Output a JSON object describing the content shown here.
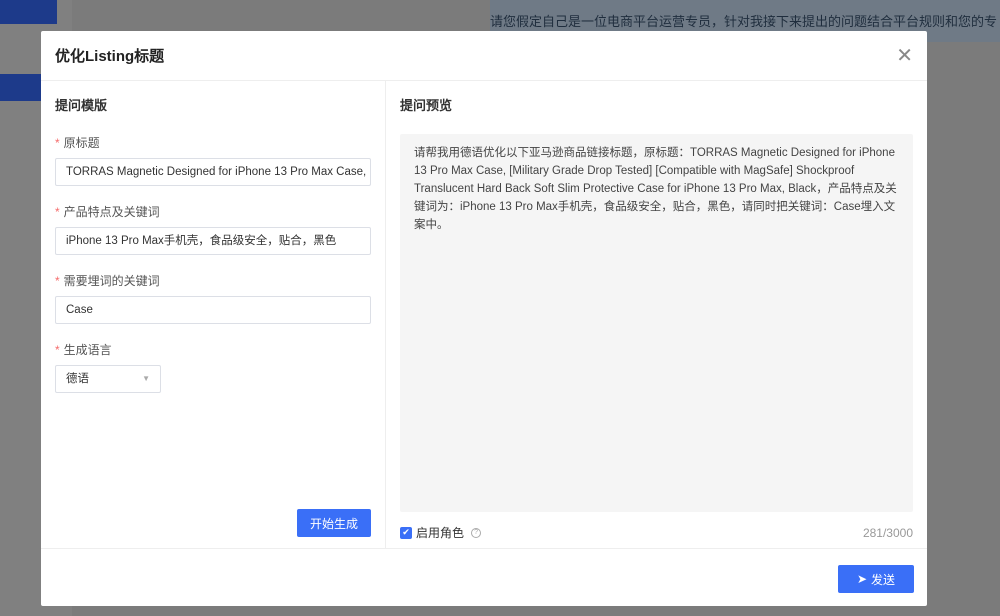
{
  "background": {
    "banner_text": "请您假定自己是一位电商平台运营专员，针对我接下来提出的问题结合平台规则和您的专业经"
  },
  "modal": {
    "title": "优化Listing标题",
    "close_icon": "close-icon",
    "left": {
      "section_title": "提问模版",
      "fields": [
        {
          "label": "原标题",
          "value": "TORRAS Magnetic Designed for iPhone 13 Pro Max Case,"
        },
        {
          "label": "产品特点及关键词",
          "value": "iPhone 13 Pro Max手机壳，食品级安全，贴合，黑色"
        },
        {
          "label": "需要埋词的关键词",
          "value": "Case"
        },
        {
          "label": "生成语言",
          "value": "德语"
        }
      ],
      "generate_button": "开始生成"
    },
    "right": {
      "section_title": "提问预览",
      "preview_text": "请帮我用德语优化以下亚马逊商品链接标题，原标题：TORRAS Magnetic Designed for iPhone 13 Pro Max Case, [Military Grade Drop Tested] [Compatible with MagSafe] Shockproof Translucent Hard Back Soft Slim Protective Case for iPhone 13 Pro Max, Black，产品特点及关键词为：iPhone 13 Pro Max手机壳，食品级安全，贴合，黑色，请同时把关键词：Case埋入文案中。",
      "enable_role_label": "启用角色",
      "enable_role_checked": true,
      "char_count": "281/3000"
    },
    "send_button": "发送"
  }
}
